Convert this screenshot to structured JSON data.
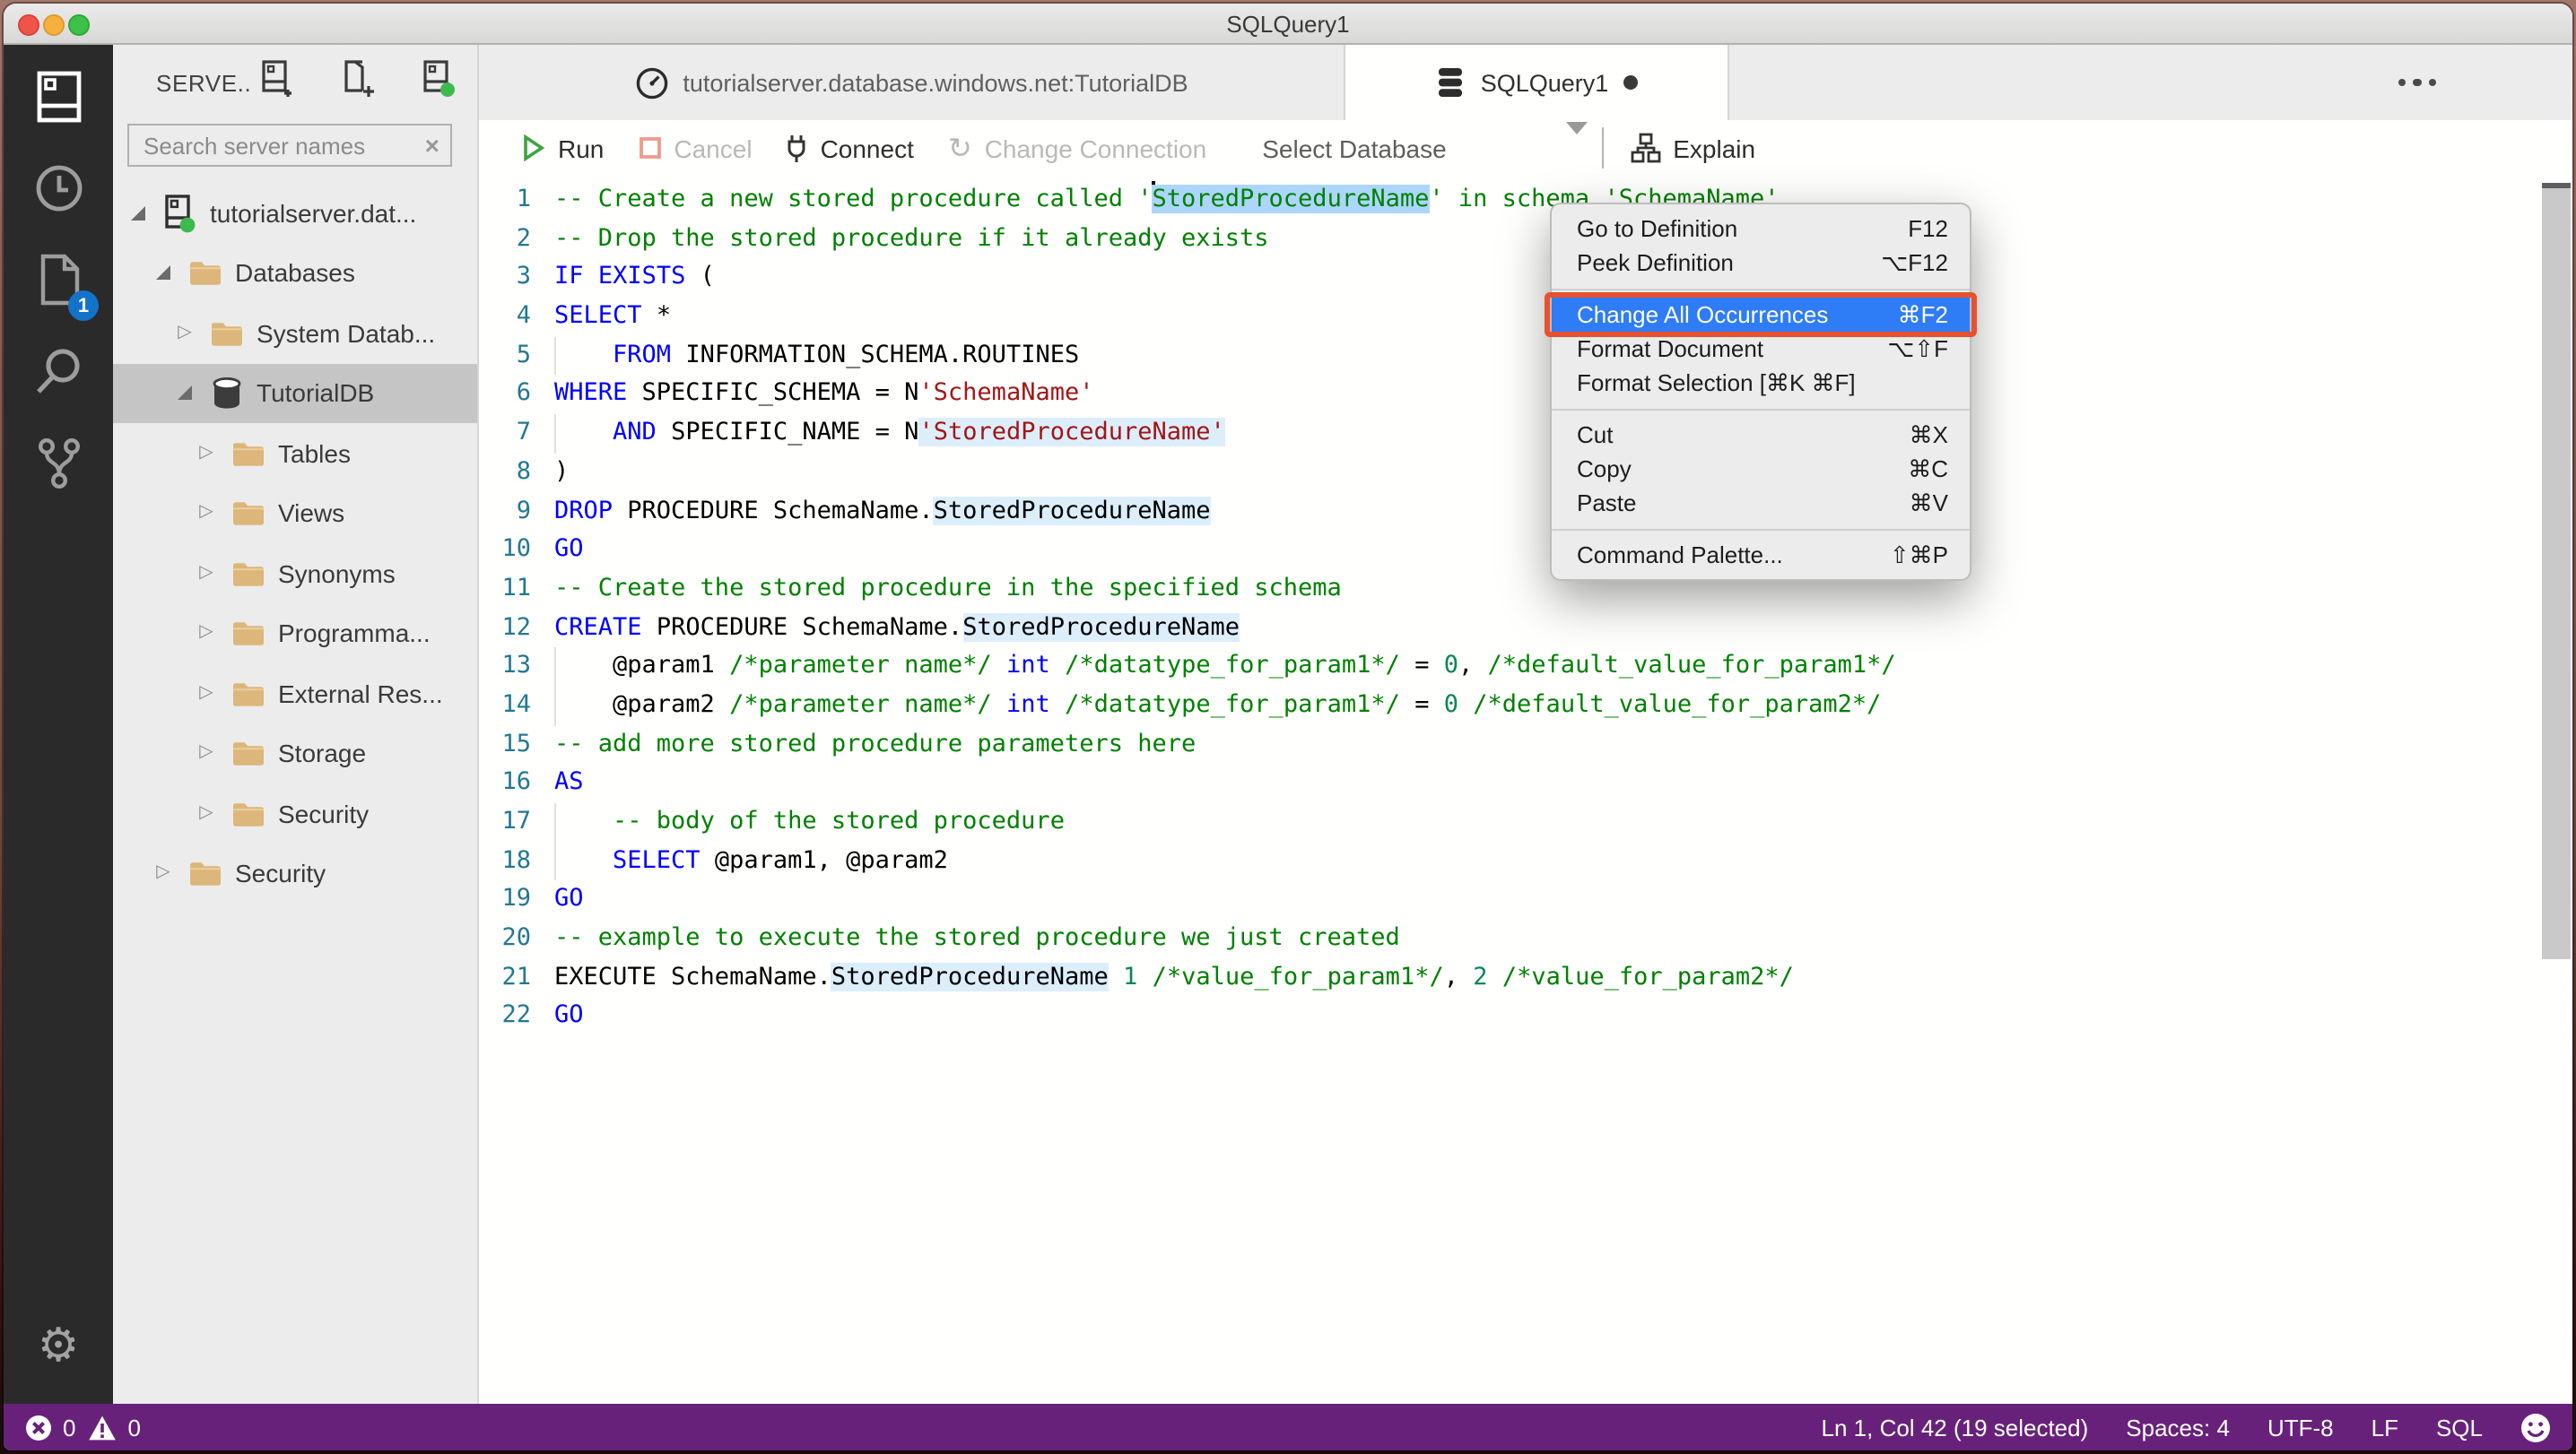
{
  "window": {
    "title": "SQLQuery1"
  },
  "colors": {
    "status_bar": "#68217a",
    "menu_highlight": "#2e7cf6",
    "annotation_box": "#e8512d",
    "selection": "#add6ff",
    "occurrence": "#ddeefb",
    "folder": "#dcb67a",
    "comment": "#008000",
    "keyword": "#0000ff",
    "string": "#a31515",
    "number": "#098658",
    "line_number": "#237893",
    "badge": "#1273c8",
    "run_green": "#3fa43f",
    "cancel_red": "#ef9a8c"
  },
  "activity_bar": {
    "items": [
      {
        "name": "servers",
        "icon": "servers-icon",
        "active": true,
        "badge": ""
      },
      {
        "name": "task-history",
        "icon": "clock-icon",
        "active": false,
        "badge": ""
      },
      {
        "name": "notebooks",
        "icon": "file-icon",
        "active": false,
        "badge": "1"
      },
      {
        "name": "search",
        "icon": "search-icon",
        "active": false,
        "badge": ""
      },
      {
        "name": "source-control",
        "icon": "branch-icon",
        "active": false,
        "badge": ""
      }
    ],
    "bottom": {
      "name": "settings",
      "icon": "gear-icon"
    }
  },
  "sidebar": {
    "header": {
      "title": "SERVE..",
      "icons": [
        {
          "name": "new-connection",
          "icon": "server-plus-icon"
        },
        {
          "name": "new-server-group",
          "icon": "group-plus-icon"
        },
        {
          "name": "active-connections",
          "icon": "server-active-icon"
        }
      ]
    },
    "search": {
      "placeholder": "Search server names",
      "clear": "×"
    },
    "tree": [
      {
        "label": "tutorialserver.dat...",
        "icon": "server",
        "arrow": "expanded",
        "level": 0,
        "selected": false
      },
      {
        "label": "Databases",
        "icon": "folder",
        "arrow": "expanded",
        "level": 1,
        "selected": false
      },
      {
        "label": "System Datab...",
        "icon": "folder",
        "arrow": "collapsed",
        "level": 2,
        "selected": false
      },
      {
        "label": "TutorialDB",
        "icon": "database",
        "arrow": "expanded",
        "level": 2,
        "selected": true
      },
      {
        "label": "Tables",
        "icon": "folder",
        "arrow": "collapsed",
        "level": 3,
        "selected": false
      },
      {
        "label": "Views",
        "icon": "folder",
        "arrow": "collapsed",
        "level": 3,
        "selected": false
      },
      {
        "label": "Synonyms",
        "icon": "folder",
        "arrow": "collapsed",
        "level": 3,
        "selected": false
      },
      {
        "label": "Programma...",
        "icon": "folder",
        "arrow": "collapsed",
        "level": 3,
        "selected": false
      },
      {
        "label": "External Res...",
        "icon": "folder",
        "arrow": "collapsed",
        "level": 3,
        "selected": false
      },
      {
        "label": "Storage",
        "icon": "folder",
        "arrow": "collapsed",
        "level": 3,
        "selected": false
      },
      {
        "label": "Security",
        "icon": "folder",
        "arrow": "collapsed",
        "level": 3,
        "selected": false
      },
      {
        "label": "Security",
        "icon": "folder",
        "arrow": "collapsed",
        "level": 1,
        "selected": false
      }
    ]
  },
  "tabs": {
    "items": [
      {
        "label": "tutorialserver.database.windows.net:TutorialDB",
        "icon": "gauge-icon",
        "active": false,
        "dirty": false
      },
      {
        "label": "SQLQuery1",
        "icon": "database-stack-icon",
        "active": true,
        "dirty": true
      }
    ],
    "more_actions": "more-actions-icon"
  },
  "toolbar": {
    "items": [
      {
        "label": "Run",
        "icon": "run-icon",
        "enabled": true,
        "type": "button"
      },
      {
        "label": "Cancel",
        "icon": "cancel-icon",
        "enabled": false,
        "type": "button"
      },
      {
        "label": "Connect",
        "icon": "plug-icon",
        "enabled": true,
        "type": "button"
      },
      {
        "label": "Change Connection",
        "icon": "refresh-icon",
        "enabled": false,
        "type": "button"
      },
      {
        "label": "Select Database",
        "icon": "chevron-down-icon",
        "enabled": true,
        "type": "dropdown"
      },
      {
        "type": "separator"
      },
      {
        "label": "Explain",
        "icon": "flowchart-icon",
        "enabled": true,
        "type": "button"
      }
    ]
  },
  "editor": {
    "selection_note": "StoredProcedureName selected on line 1, caret at col 42",
    "lines": [
      {
        "no": 1,
        "guide": false,
        "seg": [
          {
            "t": "-- Create a new stored procedure called '",
            "c": "cm"
          },
          {
            "t": "StoredProcedureName",
            "c": "cm",
            "hl": "sel",
            "caret": true
          },
          {
            "t": "' in schema 'SchemaName'",
            "c": "cm"
          }
        ]
      },
      {
        "no": 2,
        "guide": false,
        "seg": [
          {
            "t": "-- Drop the stored procedure if it already exists",
            "c": "cm"
          }
        ]
      },
      {
        "no": 3,
        "guide": false,
        "seg": [
          {
            "t": "IF",
            "c": "k"
          },
          {
            "t": " ",
            "c": "p"
          },
          {
            "t": "EXISTS",
            "c": "k"
          },
          {
            "t": " (",
            "c": "p"
          }
        ]
      },
      {
        "no": 4,
        "guide": false,
        "seg": [
          {
            "t": "SELECT",
            "c": "k"
          },
          {
            "t": " *",
            "c": "p"
          }
        ]
      },
      {
        "no": 5,
        "guide": true,
        "seg": [
          {
            "t": "    ",
            "c": "p"
          },
          {
            "t": "FROM",
            "c": "k"
          },
          {
            "t": " INFORMATION_SCHEMA.ROUTINES",
            "c": "p"
          }
        ]
      },
      {
        "no": 6,
        "guide": false,
        "seg": [
          {
            "t": "WHERE",
            "c": "k"
          },
          {
            "t": " SPECIFIC_SCHEMA = N",
            "c": "p"
          },
          {
            "t": "'SchemaName'",
            "c": "s"
          }
        ]
      },
      {
        "no": 7,
        "guide": true,
        "seg": [
          {
            "t": "    ",
            "c": "p"
          },
          {
            "t": "AND",
            "c": "k"
          },
          {
            "t": " SPECIFIC_NAME = N",
            "c": "p"
          },
          {
            "t": "'StoredProcedureName'",
            "c": "s",
            "hl": "occ"
          }
        ]
      },
      {
        "no": 8,
        "guide": false,
        "seg": [
          {
            "t": ")",
            "c": "p"
          }
        ]
      },
      {
        "no": 9,
        "guide": false,
        "seg": [
          {
            "t": "DROP",
            "c": "k"
          },
          {
            "t": " PROCEDURE SchemaName.",
            "c": "p"
          },
          {
            "t": "StoredProcedureName",
            "c": "p",
            "hl": "occ"
          }
        ]
      },
      {
        "no": 10,
        "guide": false,
        "seg": [
          {
            "t": "GO",
            "c": "k"
          }
        ]
      },
      {
        "no": 11,
        "guide": false,
        "seg": [
          {
            "t": "-- Create the stored procedure in the specified schema",
            "c": "cm"
          }
        ]
      },
      {
        "no": 12,
        "guide": false,
        "seg": [
          {
            "t": "CREATE",
            "c": "k"
          },
          {
            "t": " PROCEDURE SchemaName.",
            "c": "p"
          },
          {
            "t": "StoredProcedureName",
            "c": "p",
            "hl": "occ"
          }
        ]
      },
      {
        "no": 13,
        "guide": true,
        "seg": [
          {
            "t": "    @param1 ",
            "c": "p"
          },
          {
            "t": "/*parameter name*/",
            "c": "cm"
          },
          {
            "t": " ",
            "c": "p"
          },
          {
            "t": "int",
            "c": "k"
          },
          {
            "t": " ",
            "c": "p"
          },
          {
            "t": "/*datatype_for_param1*/",
            "c": "cm"
          },
          {
            "t": " = ",
            "c": "p"
          },
          {
            "t": "0",
            "c": "n"
          },
          {
            "t": ", ",
            "c": "p"
          },
          {
            "t": "/*default_value_for_param1*/",
            "c": "cm"
          }
        ]
      },
      {
        "no": 14,
        "guide": true,
        "seg": [
          {
            "t": "    @param2 ",
            "c": "p"
          },
          {
            "t": "/*parameter name*/",
            "c": "cm"
          },
          {
            "t": " ",
            "c": "p"
          },
          {
            "t": "int",
            "c": "k"
          },
          {
            "t": " ",
            "c": "p"
          },
          {
            "t": "/*datatype_for_param1*/",
            "c": "cm"
          },
          {
            "t": " = ",
            "c": "p"
          },
          {
            "t": "0",
            "c": "n"
          },
          {
            "t": " ",
            "c": "p"
          },
          {
            "t": "/*default_value_for_param2*/",
            "c": "cm"
          }
        ]
      },
      {
        "no": 15,
        "guide": false,
        "seg": [
          {
            "t": "-- add more stored procedure parameters here",
            "c": "cm"
          }
        ]
      },
      {
        "no": 16,
        "guide": false,
        "seg": [
          {
            "t": "AS",
            "c": "k"
          }
        ]
      },
      {
        "no": 17,
        "guide": true,
        "seg": [
          {
            "t": "    ",
            "c": "p"
          },
          {
            "t": "-- body of the stored procedure",
            "c": "cm"
          }
        ]
      },
      {
        "no": 18,
        "guide": true,
        "seg": [
          {
            "t": "    ",
            "c": "p"
          },
          {
            "t": "SELECT",
            "c": "k"
          },
          {
            "t": " @param1, @param2",
            "c": "p"
          }
        ]
      },
      {
        "no": 19,
        "guide": false,
        "seg": [
          {
            "t": "GO",
            "c": "k"
          }
        ]
      },
      {
        "no": 20,
        "guide": false,
        "seg": [
          {
            "t": "-- example to execute the stored procedure we just created",
            "c": "cm"
          }
        ]
      },
      {
        "no": 21,
        "guide": false,
        "seg": [
          {
            "t": "EXECUTE SchemaName.",
            "c": "p"
          },
          {
            "t": "StoredProcedureName",
            "c": "p",
            "hl": "occ"
          },
          {
            "t": " ",
            "c": "p"
          },
          {
            "t": "1",
            "c": "n"
          },
          {
            "t": " ",
            "c": "p"
          },
          {
            "t": "/*value_for_param1*/",
            "c": "cm"
          },
          {
            "t": ", ",
            "c": "p"
          },
          {
            "t": "2",
            "c": "n"
          },
          {
            "t": " ",
            "c": "p"
          },
          {
            "t": "/*value_for_param2*/",
            "c": "cm"
          }
        ]
      },
      {
        "no": 22,
        "guide": false,
        "seg": [
          {
            "t": "GO",
            "c": "k"
          }
        ]
      }
    ]
  },
  "context_menu": {
    "items": [
      {
        "type": "item",
        "label": "Go to Definition",
        "shortcut": "F12",
        "highlighted": false,
        "boxed": false
      },
      {
        "type": "item",
        "label": "Peek Definition",
        "shortcut": "⌥F12",
        "highlighted": false,
        "boxed": false
      },
      {
        "type": "separator"
      },
      {
        "type": "item",
        "label": "Change All Occurrences",
        "shortcut": "⌘F2",
        "highlighted": true,
        "boxed": true
      },
      {
        "type": "item",
        "label": "Format Document",
        "shortcut": "⌥⇧F",
        "highlighted": false,
        "boxed": false
      },
      {
        "type": "item",
        "label": "Format Selection [⌘K ⌘F]",
        "shortcut": "",
        "highlighted": false,
        "boxed": false
      },
      {
        "type": "separator"
      },
      {
        "type": "item",
        "label": "Cut",
        "shortcut": "⌘X",
        "highlighted": false,
        "boxed": false
      },
      {
        "type": "item",
        "label": "Copy",
        "shortcut": "⌘C",
        "highlighted": false,
        "boxed": false
      },
      {
        "type": "item",
        "label": "Paste",
        "shortcut": "⌘V",
        "highlighted": false,
        "boxed": false
      },
      {
        "type": "separator"
      },
      {
        "type": "item",
        "label": "Command Palette...",
        "shortcut": "⇧⌘P",
        "highlighted": false,
        "boxed": false
      }
    ]
  },
  "status_bar": {
    "left": [
      {
        "icon": "error-icon",
        "value": "0"
      },
      {
        "icon": "warning-icon",
        "value": "0"
      }
    ],
    "right": [
      {
        "label": "Ln 1, Col 42 (19 selected)"
      },
      {
        "label": "Spaces: 4"
      },
      {
        "label": "UTF-8"
      },
      {
        "label": "LF"
      },
      {
        "label": "SQL"
      },
      {
        "icon": "smiley-icon",
        "label": ""
      }
    ]
  }
}
